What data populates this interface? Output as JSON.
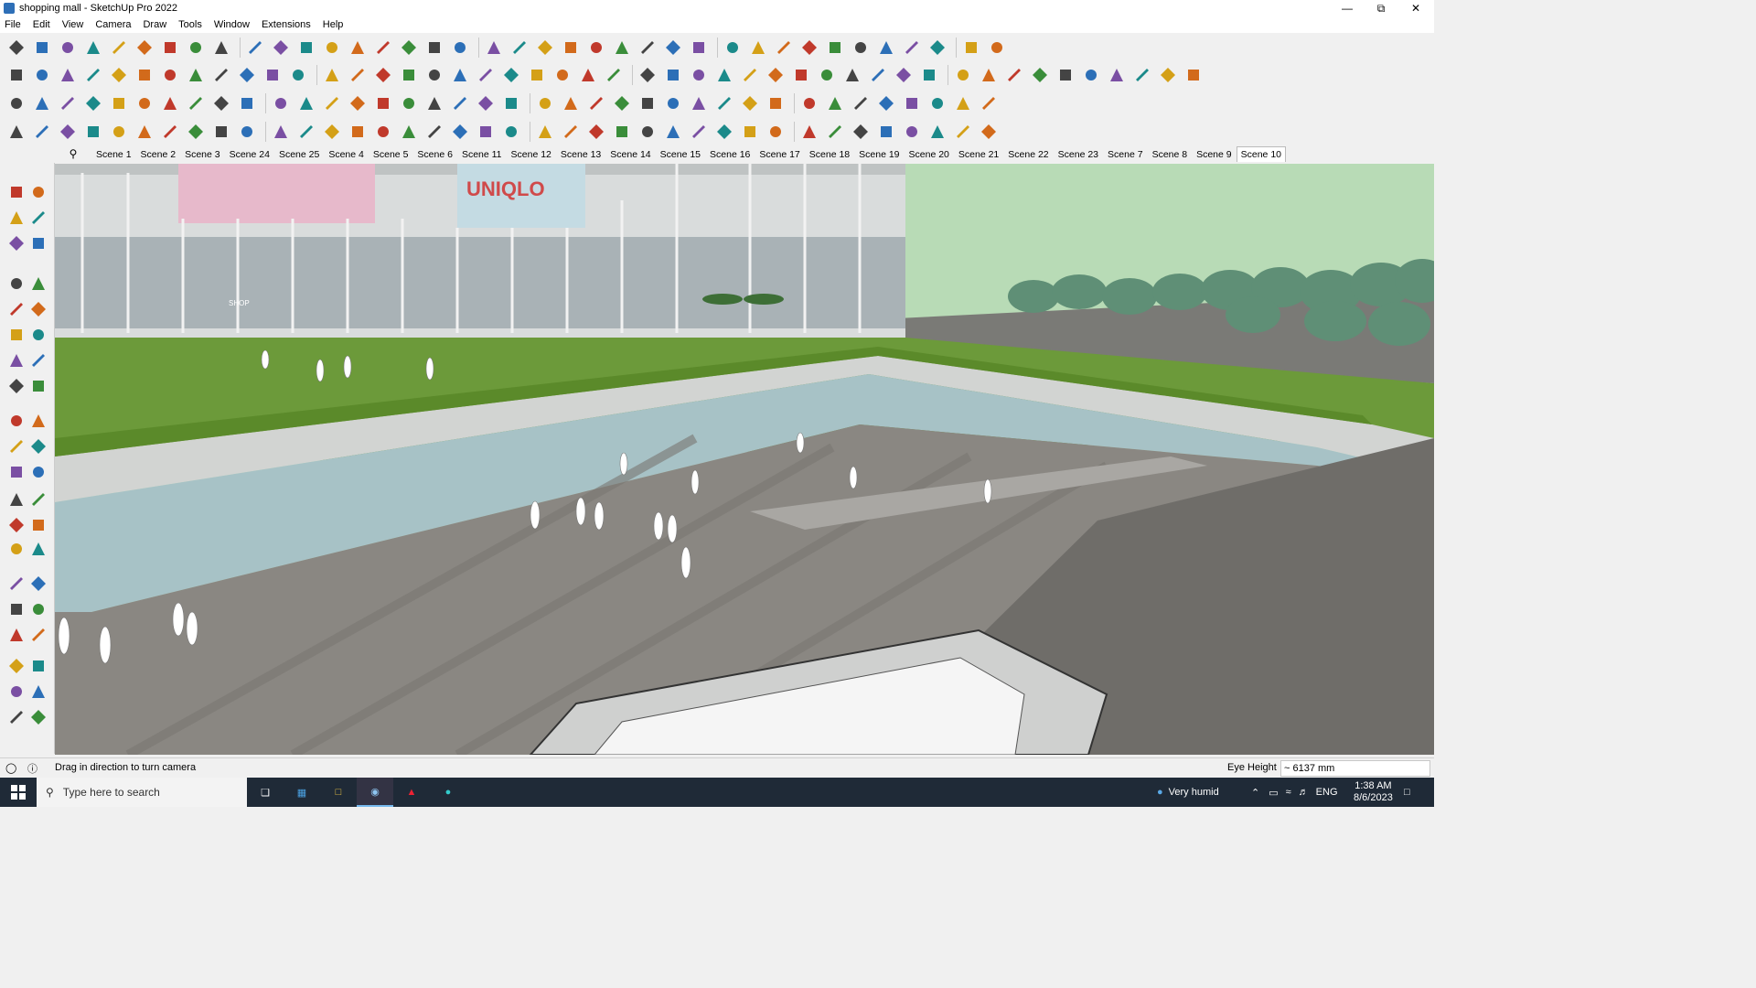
{
  "window": {
    "title": "shopping mall - SketchUp Pro 2022",
    "minimize_icon": "minimize-icon",
    "maximize_icon": "restore-icon",
    "close_icon": "close-icon"
  },
  "menu": [
    "File",
    "Edit",
    "View",
    "Camera",
    "Draw",
    "Tools",
    "Window",
    "Extensions",
    "Help"
  ],
  "scenes": {
    "tabs": [
      "Scene 1",
      "Scene 2",
      "Scene 3",
      "Scene 24",
      "Scene 25",
      "Scene 4",
      "Scene 5",
      "Scene 6",
      "Scene 11",
      "Scene 12",
      "Scene 13",
      "Scene 14",
      "Scene 15",
      "Scene 16",
      "Scene 17",
      "Scene 18",
      "Scene 19",
      "Scene 20",
      "Scene 21",
      "Scene 22",
      "Scene 23",
      "Scene 7",
      "Scene 8",
      "Scene 9",
      "Scene 10"
    ],
    "active": "Scene 10"
  },
  "viewport": {
    "signage": {
      "brand": "UNIQLO",
      "shop_sign": "SHOP"
    }
  },
  "status": {
    "hint": "Drag in direction to turn camera",
    "eye_height_label": "Eye Height",
    "eye_height_value": "~ 6137 mm"
  },
  "taskbar": {
    "search_placeholder": "Type here to search",
    "weather": "Very humid",
    "language": "ENG",
    "time": "1:38 AM",
    "date": "8/6/2023"
  },
  "colors": {
    "toolbar_bg": "#f0f0f0",
    "taskbar_bg": "#1f2a37",
    "sky": "#b8dbb6",
    "grass": "#5c8a2c",
    "plaza": "#8a8782"
  }
}
